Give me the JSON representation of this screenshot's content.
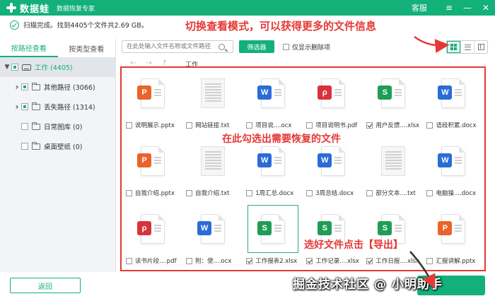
{
  "titlebar": {
    "app_name": "数据蛙",
    "app_sub": "数据恢复专家",
    "service": "客服",
    "menu_glyph": "≡",
    "min_glyph": "—",
    "close_glyph": "✕"
  },
  "scan": {
    "status": "扫描完成。找到4405个文件共2.69 GB。"
  },
  "annotations": {
    "top": "切换查看模式，可以获得更多的文件信息",
    "middle": "在此勾选出需要恢复的文件",
    "bottom": "选好文件点击【导出】"
  },
  "left_panel": {
    "tabs": [
      "按路径查看",
      "按类型查看"
    ],
    "tree": [
      {
        "label": "工作 (4405)",
        "expand": "▼"
      },
      {
        "label": "其他路径 (3066)",
        "expand": "›"
      },
      {
        "label": "丢失路径 (1314)",
        "expand": "›"
      },
      {
        "label": "日常图库 (0)",
        "expand": ""
      },
      {
        "label": "桌面壁纸 (0)",
        "expand": ""
      }
    ]
  },
  "toolbar": {
    "search_placeholder": "在此处输入文件名称或文件路径",
    "filter_label": "筛选器",
    "only_deleted_label": "仅显示删除项"
  },
  "navigation": {
    "back": "←",
    "forward": "→",
    "up": "↑",
    "breadcrumb": "工作"
  },
  "files": [
    {
      "name": "说明展示.pptx",
      "type": "ppt",
      "badge": "P",
      "checked": false
    },
    {
      "name": "网站链接.txt",
      "type": "txt",
      "badge": "",
      "checked": false
    },
    {
      "name": "项目说....ocx",
      "type": "word",
      "badge": "W",
      "checked": false
    },
    {
      "name": "项目说明书.pdf",
      "type": "pdf",
      "badge": "ρ",
      "checked": false
    },
    {
      "name": "用户反馈....xlsx",
      "type": "excel",
      "badge": "S",
      "checked": true
    },
    {
      "name": "语段积累.docx",
      "type": "word",
      "badge": "W",
      "checked": false
    },
    {
      "name": "自我介绍.pptx",
      "type": "ppt",
      "badge": "P",
      "checked": false
    },
    {
      "name": "自我介绍.txt",
      "type": "txt",
      "badge": "",
      "checked": false
    },
    {
      "name": "1周汇总.docx",
      "type": "word",
      "badge": "W",
      "checked": false
    },
    {
      "name": "3周总结.docx",
      "type": "word",
      "badge": "W",
      "checked": false
    },
    {
      "name": "部分文本....txt",
      "type": "txt",
      "badge": "",
      "checked": false
    },
    {
      "name": "电脑操....docx",
      "type": "word",
      "badge": "W",
      "checked": false
    },
    {
      "name": "读书片段....pdf",
      "type": "pdf",
      "badge": "ρ",
      "checked": false
    },
    {
      "name": "附：使....ocx",
      "type": "word",
      "badge": "W",
      "checked": false
    },
    {
      "name": "工作报表2.xlsx",
      "type": "excel",
      "badge": "S",
      "checked": true,
      "selected": true
    },
    {
      "name": "工作记录....xlsx",
      "type": "excel",
      "badge": "S",
      "checked": true
    },
    {
      "name": "工作日报....xlsx",
      "type": "excel",
      "badge": "S",
      "checked": true
    },
    {
      "name": "汇报讲解.pptx",
      "type": "ppt",
      "badge": "P",
      "checked": false
    }
  ],
  "footer": {
    "back_label": "返回"
  },
  "watermark": "掘金技术社区 @ 小明助手",
  "colors": {
    "brand": "#13b07a",
    "annotation": "#e53935"
  }
}
